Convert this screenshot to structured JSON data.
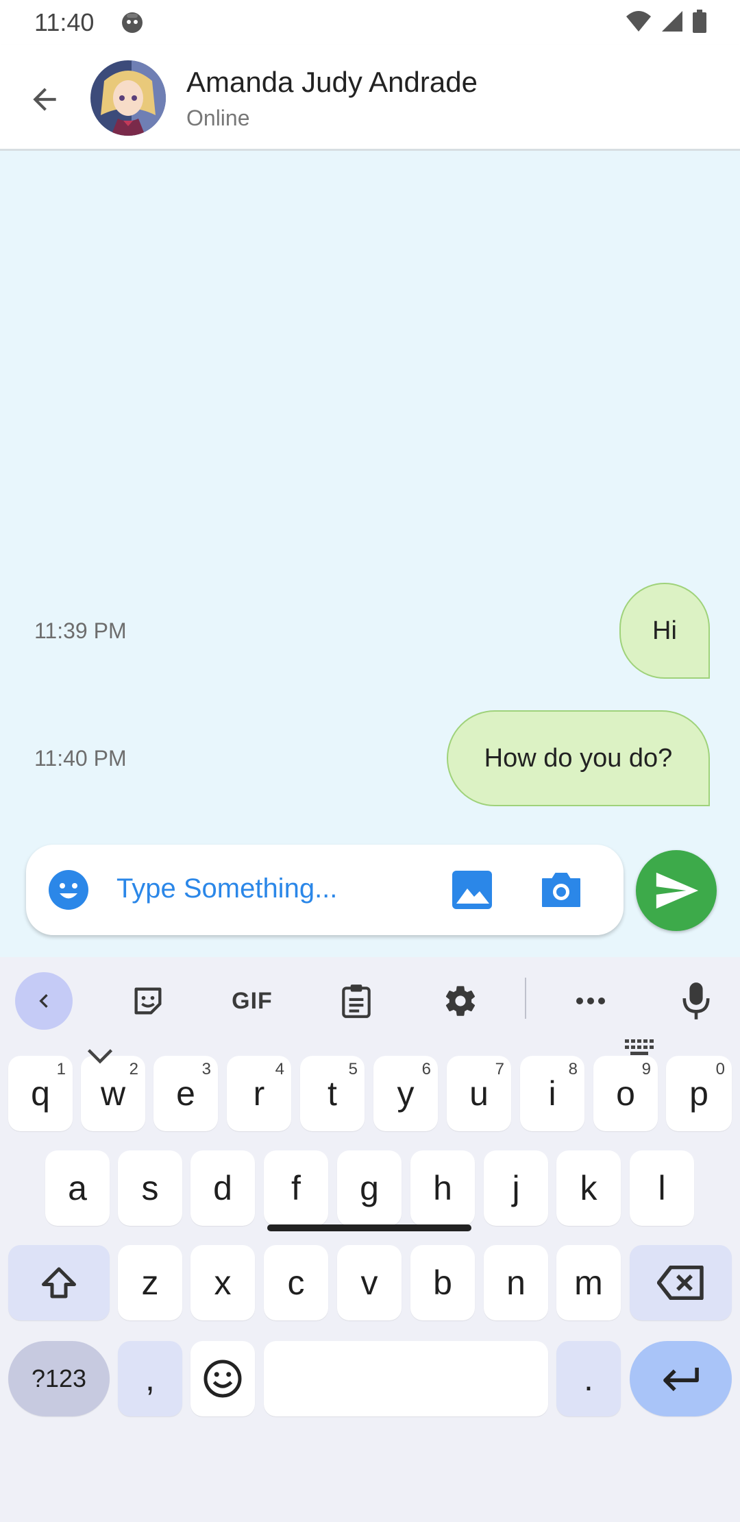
{
  "status_bar": {
    "time": "11:40"
  },
  "header": {
    "contact_name": "Amanda Judy Andrade",
    "contact_status": "Online"
  },
  "messages": [
    {
      "time": "11:39 PM",
      "text": "Hi"
    },
    {
      "time": "11:40 PM",
      "text": "How do you do?"
    }
  ],
  "composer": {
    "placeholder": "Type Something..."
  },
  "keyboard": {
    "toolbar": {
      "gif_label": "GIF"
    },
    "row1": [
      {
        "k": "q",
        "h": "1"
      },
      {
        "k": "w",
        "h": "2"
      },
      {
        "k": "e",
        "h": "3"
      },
      {
        "k": "r",
        "h": "4"
      },
      {
        "k": "t",
        "h": "5"
      },
      {
        "k": "y",
        "h": "6"
      },
      {
        "k": "u",
        "h": "7"
      },
      {
        "k": "i",
        "h": "8"
      },
      {
        "k": "o",
        "h": "9"
      },
      {
        "k": "p",
        "h": "0"
      }
    ],
    "row2": [
      "a",
      "s",
      "d",
      "f",
      "g",
      "h",
      "j",
      "k",
      "l"
    ],
    "row3": [
      "z",
      "x",
      "c",
      "v",
      "b",
      "n",
      "m"
    ],
    "symbols_label": "?123",
    "comma_label": ",",
    "period_label": "."
  },
  "colors": {
    "chat_background": "#e8f6fc",
    "bubble_fill": "#dcf2c4",
    "bubble_border": "#9fd27a",
    "send_button": "#3daa4a",
    "accent_blue": "#2b87e8"
  }
}
